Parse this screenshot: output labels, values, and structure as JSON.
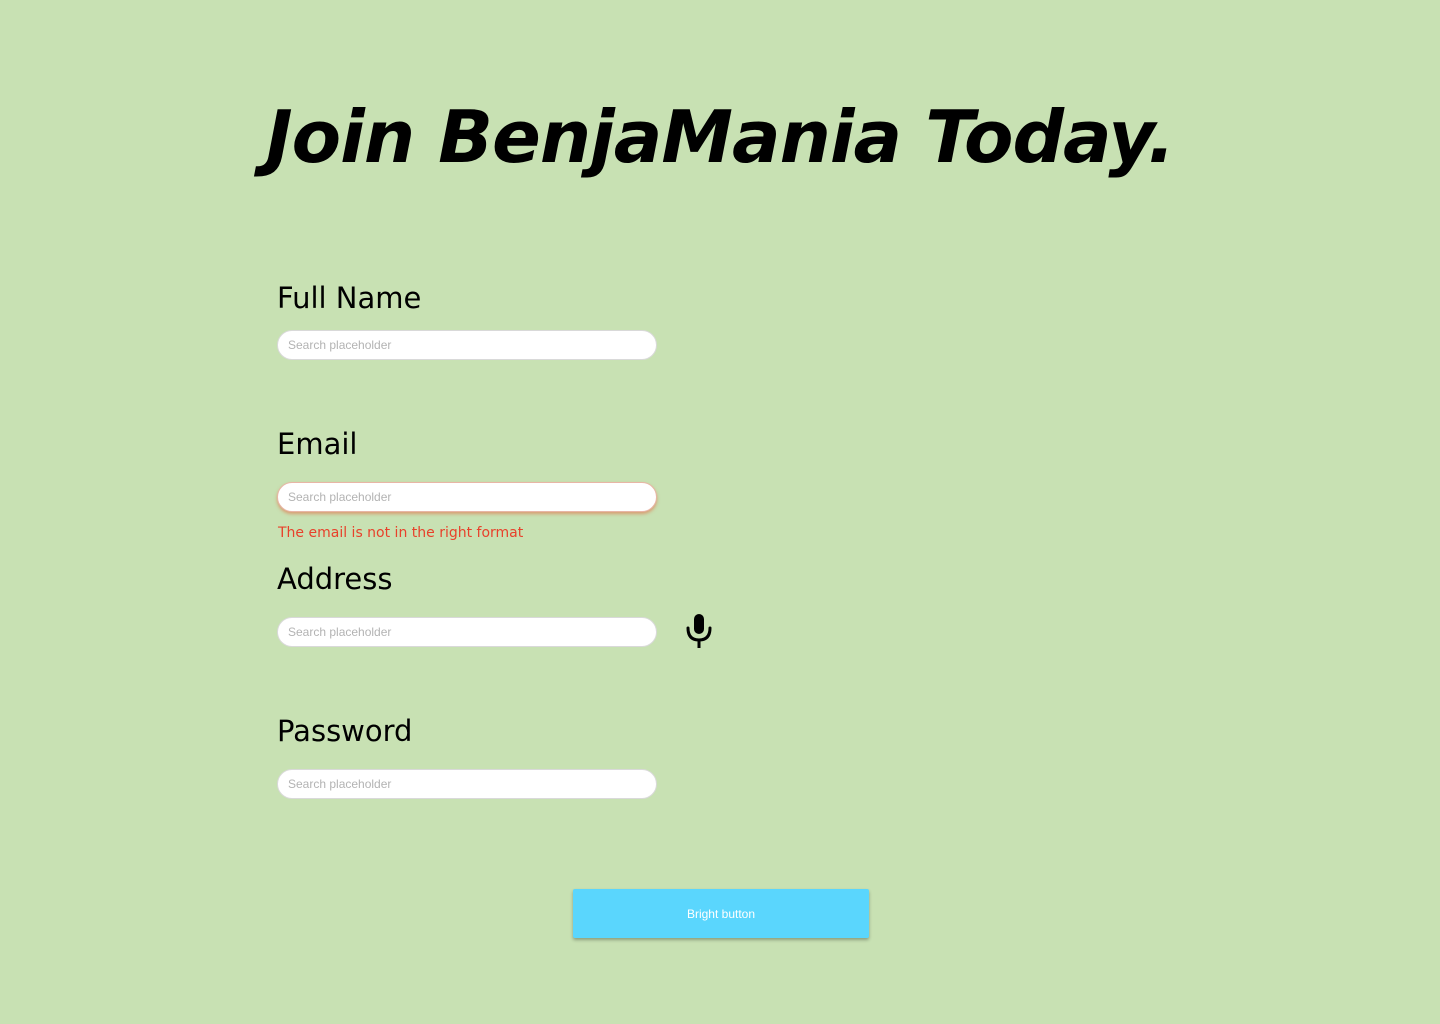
{
  "page": {
    "title": "Join BenjaMania Today.",
    "background_color": "#c8e1b3"
  },
  "form": {
    "full_name": {
      "label": "Full Name",
      "placeholder": "Search placeholder",
      "value": ""
    },
    "email": {
      "label": "Email",
      "placeholder": "Search placeholder",
      "value": "",
      "error": "The email is not in the right format",
      "error_color": "#e8412b"
    },
    "address": {
      "label": "Address",
      "placeholder": "Search placeholder",
      "value": "",
      "voice_icon": "microphone-icon"
    },
    "password": {
      "label": "Password",
      "placeholder": "Search placeholder",
      "value": ""
    }
  },
  "submit_button": {
    "label": "Bright button",
    "color": "#5ad6fd"
  }
}
